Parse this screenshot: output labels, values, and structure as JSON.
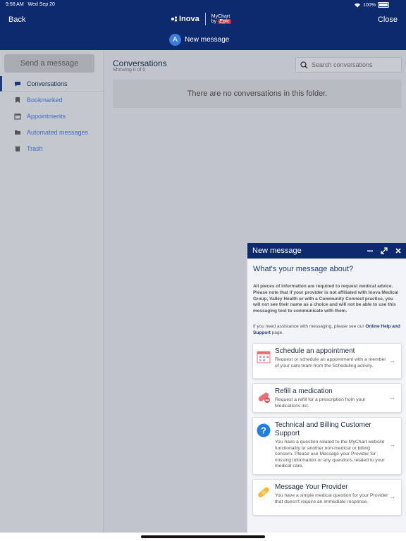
{
  "status_bar": {
    "time": "9:58 AM",
    "date": "Wed Sep 20",
    "battery": "100%"
  },
  "header": {
    "back_label": "Back",
    "close_label": "Close",
    "brand_name": "Inova",
    "mychart_label": "MyChart",
    "mychart_by": "by",
    "epic_label": "Epic",
    "avatar_initial": "A",
    "new_message_label": "New message"
  },
  "sidebar": {
    "send_button": "Send a message",
    "items": [
      {
        "label": "Conversations",
        "icon": "chat-bubble-icon",
        "active": true
      },
      {
        "label": "Bookmarked",
        "icon": "bookmark-icon"
      },
      {
        "label": "Appointments",
        "icon": "calendar-icon"
      },
      {
        "label": "Automated messages",
        "icon": "folder-icon"
      },
      {
        "label": "Trash",
        "icon": "trash-icon"
      }
    ]
  },
  "main": {
    "title": "Conversations",
    "subtitle": "Showing 0 of 0",
    "search_placeholder": "Search conversations",
    "empty_text": "There are no conversations in this folder."
  },
  "dialog": {
    "title": "New message",
    "question": "What's your message about?",
    "disclaimer": "All pieces of information are required to request medical advice. Please note that if your provider is not affiliated with Inova Medical Group, Valley Health or with a Community Connect practice, you will not see their name as a choice and will not be able to use this messaging tool to communicate with them.",
    "help_prefix": "If you need assistance with messaging, please see our",
    "help_link": "Online Help and Support",
    "help_suffix": "page.",
    "cards": [
      {
        "title": "Schedule an appointment",
        "description": "Request or schedule an appointment with a member of your care team from the Scheduling activity.",
        "icon": "calendar-icon"
      },
      {
        "title": "Refill a medication",
        "description": "Request a refill for a prescription from your Medications list.",
        "icon": "pill-icon"
      },
      {
        "title": "Technical and Billing Customer Support",
        "description": "You have a question related to the MyChart website functionality or another non-medical or billing concern. Please use Message your Provider for missing information or any questions related to your medical care.",
        "icon": "question-icon"
      },
      {
        "title": "Message Your Provider",
        "description": "You have a simple medical question for your Provider that doesn't require an immediate response.",
        "icon": "bandage-icon"
      }
    ]
  },
  "colors": {
    "header": "#0d2a6e",
    "link": "#3f6cc0",
    "accent": "#3b7dd8"
  }
}
